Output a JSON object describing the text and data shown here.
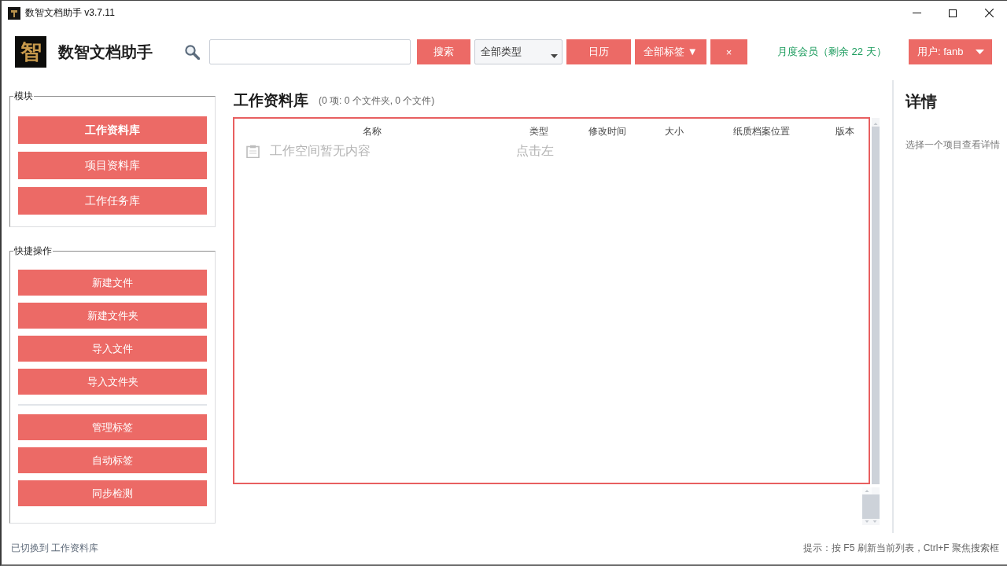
{
  "window": {
    "title": "数智文档助手 v3.7.11"
  },
  "header": {
    "logo_glyph": "智",
    "app_name": "数智文档助手",
    "toolbar": [
      {
        "kind": "button",
        "label": "搜索"
      },
      {
        "kind": "dropdown",
        "value": "全部类型"
      },
      {
        "kind": "button",
        "label": "日历"
      },
      {
        "kind": "button",
        "label": "全部标签 ▼"
      },
      {
        "kind": "button",
        "label": "×"
      }
    ],
    "membership": "月度会员（剩余 22 天）",
    "user_menu": {
      "label": "用户: fanb"
    }
  },
  "sidebar": {
    "groups": [
      {
        "kind": "nav",
        "title": "模块",
        "sections": [
          [
            {
              "label": "工作资料库",
              "selected": true
            },
            {
              "label": "项目资料库",
              "selected": false
            },
            {
              "label": "工作任务库",
              "selected": false
            }
          ]
        ]
      },
      {
        "kind": "actions",
        "title": "快捷操作",
        "sections": [
          [
            {
              "label": "新建文件"
            },
            {
              "label": "新建文件夹"
            },
            {
              "label": "导入文件"
            },
            {
              "label": "导入文件夹"
            }
          ],
          [
            {
              "label": "管理标签"
            },
            {
              "label": "自动标签"
            },
            {
              "label": "同步检测"
            }
          ]
        ]
      }
    ]
  },
  "main": {
    "title": "工作资料库",
    "summary": "(0 项: 0 个文件夹, 0 个文件)",
    "table": {
      "columns": [
        "名称",
        "类型",
        "修改时间",
        "大小",
        "纸质档案位置",
        "版本"
      ],
      "rows": [
        {
          "cells": [
            "工作空间暂无内容",
            "点击左"
          ]
        }
      ]
    }
  },
  "details": {
    "title": "详情",
    "hint": "选择一个项目查看详情"
  },
  "status_bar": {
    "left": "已切换到 工作资料库",
    "right": "提示：按 F5 刷新当前列表，Ctrl+F 聚焦搜索框"
  }
}
